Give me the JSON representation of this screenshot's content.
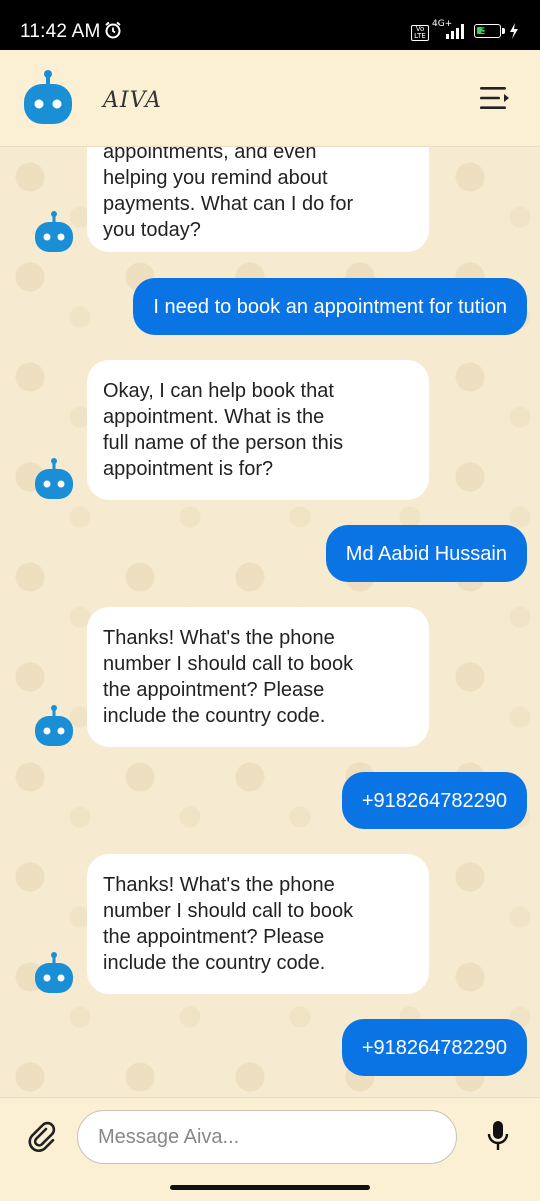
{
  "status_bar": {
    "time": "11:42 AM",
    "network": "4G+",
    "volte": "Vo LTE",
    "battery": "39",
    "battery_percent": 39
  },
  "header": {
    "brand": "AIVA",
    "avatar_icon": "robot-icon",
    "menu_icon": "menu-icon"
  },
  "messages": [
    {
      "sender": "bot",
      "lines": [
        "appointments, and even",
        "helping you remind about",
        "payments. What can I do for",
        "you today?"
      ]
    },
    {
      "sender": "user",
      "text": "I need to book an appointment for tution"
    },
    {
      "sender": "bot",
      "lines": [
        "Okay, I can help book that",
        "appointment. What is the",
        "full name of the person this",
        "appointment is for?"
      ]
    },
    {
      "sender": "user",
      "text": "Md Aabid Hussain"
    },
    {
      "sender": "bot",
      "lines": [
        "Thanks! What's the phone",
        "number I should call to book",
        "the appointment? Please",
        "include the country code."
      ]
    },
    {
      "sender": "user",
      "text": "+918264782290"
    },
    {
      "sender": "bot",
      "lines": [
        "Thanks! What's the phone",
        "number I should call to book",
        "the appointment? Please",
        "include the country code."
      ]
    },
    {
      "sender": "user",
      "text": "+918264782290"
    }
  ],
  "input": {
    "placeholder": "Message Aiva...",
    "value": ""
  },
  "colors": {
    "user_bubble": "#0b74e5",
    "bot_bubble": "#ffffff",
    "bot_icon": "#1a8fd6",
    "background": "#f7ecd2"
  }
}
